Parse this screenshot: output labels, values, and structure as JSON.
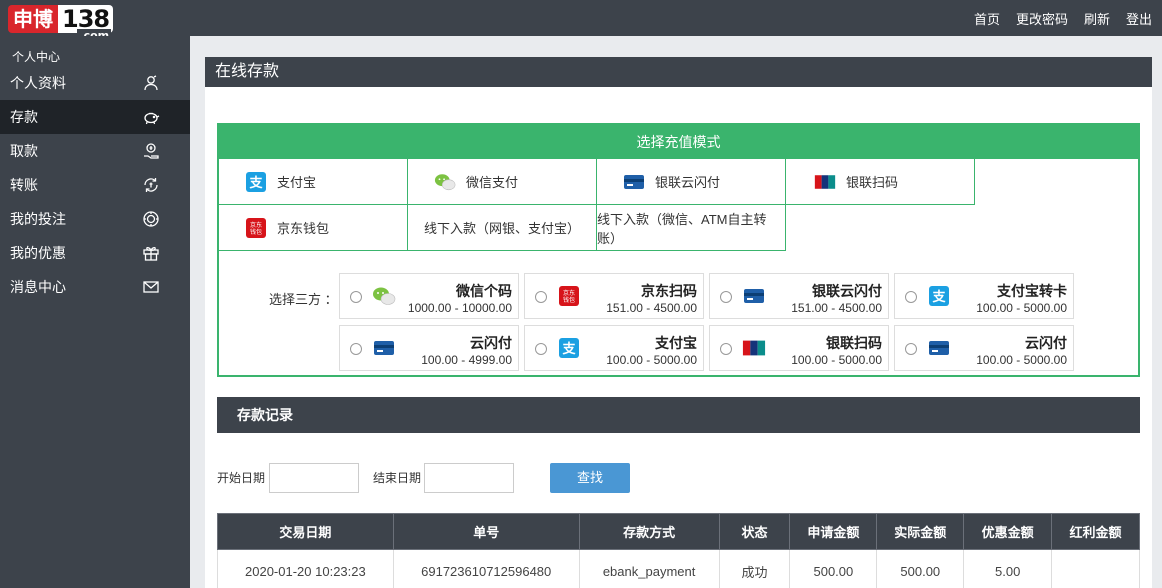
{
  "logo": {
    "brand": "申博",
    "number": "138",
    "suffix": ".com"
  },
  "topnav": [
    "首页",
    "更改密码",
    "刷新",
    "登出"
  ],
  "sidebar": {
    "title": "个人中心",
    "items": [
      {
        "label": "个人资料",
        "icon": "user-icon"
      },
      {
        "label": "存款",
        "icon": "piggy-bank-icon",
        "active": true
      },
      {
        "label": "取款",
        "icon": "hand-coin-icon"
      },
      {
        "label": "转账",
        "icon": "transfer-icon"
      },
      {
        "label": "我的投注",
        "icon": "chip-icon"
      },
      {
        "label": "我的优惠",
        "icon": "gift-icon"
      },
      {
        "label": "消息中心",
        "icon": "mail-icon"
      }
    ]
  },
  "main": {
    "title": "在线存款",
    "mode_title": "选择充值模式",
    "modes": [
      {
        "label": "支付宝",
        "icon": "alipay-icon"
      },
      {
        "label": "微信支付",
        "icon": "wechat-icon"
      },
      {
        "label": "银联云闪付",
        "icon": "card-icon"
      },
      {
        "label": "银联扫码",
        "icon": "unionpay-icon"
      },
      {
        "label": "京东钱包",
        "icon": "jd-icon"
      },
      {
        "label": "线下入款（网银、支付宝）"
      },
      {
        "label": "线下入款（微信、ATM自主转账）"
      }
    ],
    "third_label": "选择三方 ：",
    "options": [
      {
        "name": "微信个码",
        "range": "1000.00 - 10000.00",
        "icon": "wechat-icon"
      },
      {
        "name": "京东扫码",
        "range": "151.00 - 4500.00",
        "icon": "jd-icon"
      },
      {
        "name": "银联云闪付",
        "range": "151.00 - 4500.00",
        "icon": "card-icon"
      },
      {
        "name": "支付宝转卡",
        "range": "100.00 - 5000.00",
        "icon": "alipay-icon"
      },
      {
        "name": "云闪付",
        "range": "100.00 - 4999.00",
        "icon": "card-icon"
      },
      {
        "name": "支付宝",
        "range": "100.00 - 5000.00",
        "icon": "alipay-icon"
      },
      {
        "name": "银联扫码",
        "range": "100.00 - 5000.00",
        "icon": "unionpay-icon"
      },
      {
        "name": "云闪付",
        "range": "100.00 - 5000.00",
        "icon": "card-icon"
      }
    ],
    "records_title": "存款记录",
    "start_label": "开始日期",
    "end_label": "结束日期",
    "search_label": "查找",
    "columns": [
      "交易日期",
      "单号",
      "存款方式",
      "状态",
      "申请金额",
      "实际金额",
      "优惠金额",
      "红利金额"
    ],
    "rows": [
      [
        "2020-01-20 10:23:23",
        "691723610712596480",
        "ebank_payment",
        "成功",
        "500.00",
        "500.00",
        "5.00",
        ""
      ]
    ]
  },
  "colors": {
    "dark": "#3d434b",
    "green": "#3ab46d",
    "blue": "#4a97d4",
    "brand_red": "#d9262c"
  }
}
